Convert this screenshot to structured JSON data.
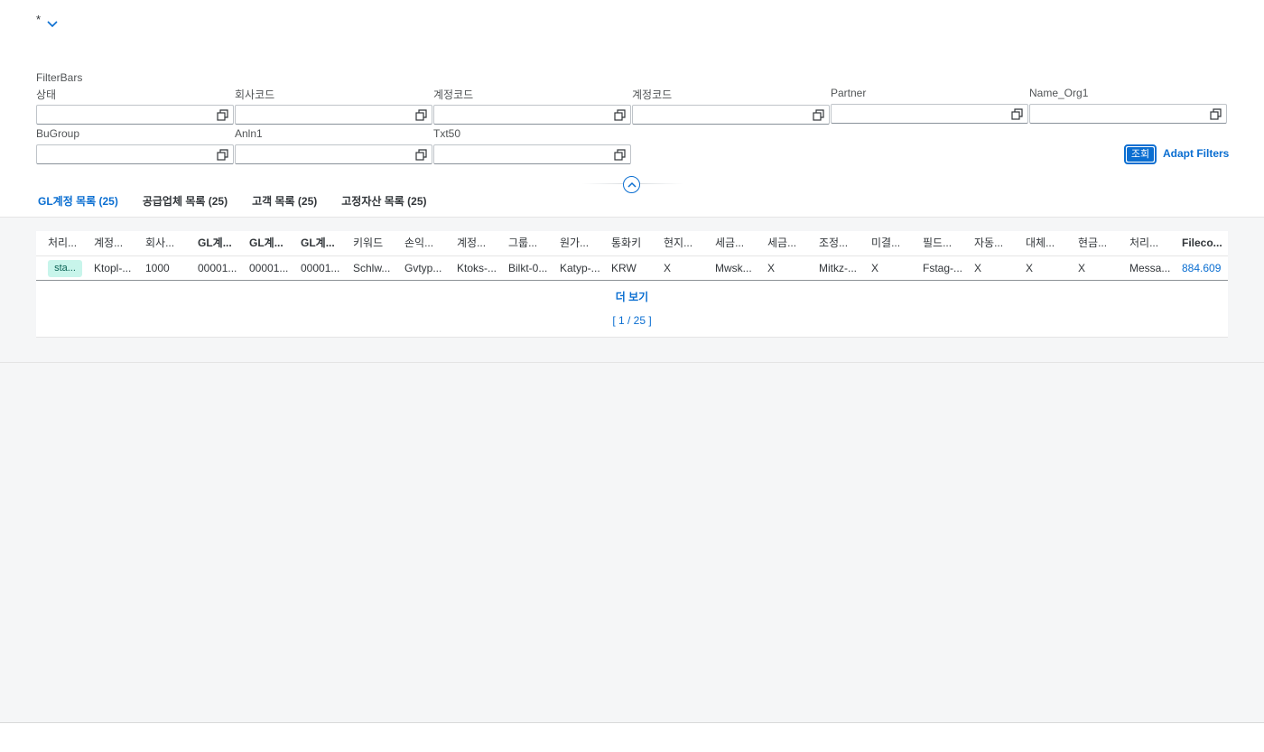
{
  "header": {
    "title": "*"
  },
  "filterbar": {
    "title": "FilterBars",
    "fields": [
      {
        "label": "상태",
        "value": ""
      },
      {
        "label": "회사코드",
        "value": ""
      },
      {
        "label": "계정코드",
        "value": ""
      },
      {
        "label": "계정코드",
        "value": ""
      },
      {
        "label": "Partner",
        "value": ""
      },
      {
        "label": "Name_Org1",
        "value": ""
      },
      {
        "label": "BuGroup",
        "value": ""
      },
      {
        "label": "Anln1",
        "value": ""
      },
      {
        "label": "Txt50",
        "value": ""
      }
    ],
    "search_label": "조회",
    "adapt_label": "Adapt Filters"
  },
  "tabs": [
    {
      "label": "GL계정 목록 (25)",
      "active": true
    },
    {
      "label": "공급업체 목록 (25)",
      "active": false
    },
    {
      "label": "고객 목록 (25)",
      "active": false
    },
    {
      "label": "고정자산 목록 (25)",
      "active": false
    }
  ],
  "table": {
    "columns": [
      "처리...",
      "계정...",
      "회사...",
      "GL계...",
      "GL계...",
      "GL계...",
      "키워드",
      "손익...",
      "계정...",
      "그룹...",
      "원가...",
      "통화키",
      "현지...",
      "세금...",
      "세금...",
      "조정...",
      "미결...",
      "필드...",
      "자동...",
      "대체...",
      "현금...",
      "처리...",
      "Fileco..."
    ],
    "rows": [
      [
        "sta...",
        "Ktopl-...",
        "1000",
        "00001...",
        "00001...",
        "00001...",
        "Schlw...",
        "Gvtyp...",
        "Ktoks-...",
        "Bilkt-0...",
        "Katyp-...",
        "KRW",
        "X",
        "Mwsk...",
        "X",
        "Mitkz-...",
        "X",
        "Fstag-...",
        "X",
        "X",
        "X",
        "Messa...",
        "884.609"
      ]
    ],
    "more_label": "더 보기",
    "count_label": "[ 1 / 25 ]"
  },
  "colors": {
    "accent": "#0a6ed1",
    "status_bg": "#c8f5eb",
    "content_bg": "#f5f6f7"
  }
}
